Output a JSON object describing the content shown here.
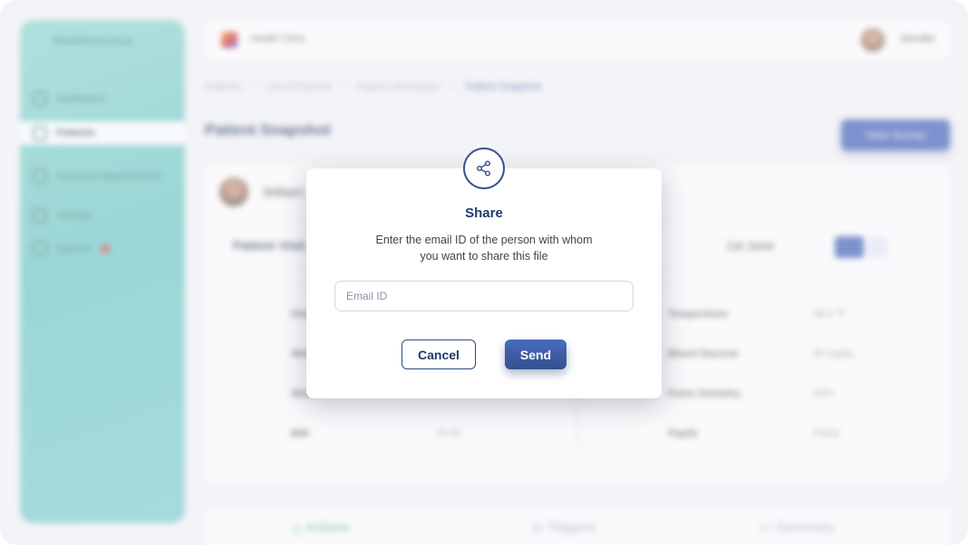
{
  "background": {
    "app_logo": "WebWorkshop",
    "sidebar": {
      "items": [
        {
          "label": "Dashboard",
          "icon": "grid-icon"
        },
        {
          "label": "Patients",
          "icon": "users-icon",
          "active": true
        },
        {
          "label": "Schedule Appointments",
          "icon": "calendar-icon"
        },
        {
          "label": "Settings",
          "icon": "gear-icon"
        },
        {
          "label": "Queries",
          "icon": "question-icon",
          "badge": true
        }
      ]
    },
    "header": {
      "title": "Health Clinic",
      "user_name": "Jennifer"
    },
    "breadcrumb": [
      "Patients",
      "List of Patients",
      "Patient Information",
      "Patient Snapshot"
    ],
    "page_title": "Patient Snapshot",
    "view_survey_label": "View Survey",
    "patient_name": "William",
    "visit": {
      "title": "Patient Visit",
      "date": "1st June"
    },
    "vitals_left": [
      {
        "label": "Height",
        "value": ""
      },
      {
        "label": "Weight",
        "value": ""
      },
      {
        "label": "Waist",
        "value": ""
      },
      {
        "label": "BMI",
        "value": "25.30"
      }
    ],
    "vitals_right": [
      {
        "label": "Temperature",
        "value": "98.6 °F"
      },
      {
        "label": "Blood Glucose",
        "value": "90 mg/dL"
      },
      {
        "label": "Pulse Oximetry",
        "value": "95%"
      },
      {
        "label": "Pupils",
        "value": "Perrla"
      }
    ],
    "bottom_tabs": [
      "Actions",
      "Triggers",
      "Summary"
    ]
  },
  "modal": {
    "title": "Share",
    "description": "Enter the email ID of the person with whom you want to share this file",
    "email_placeholder": "Email ID",
    "email_value": "",
    "cancel_label": "Cancel",
    "send_label": "Send",
    "icon": "share-icon"
  },
  "colors": {
    "primary": "#33508f",
    "title": "#1f3a6b",
    "sidebar": "#6cc9c4"
  }
}
